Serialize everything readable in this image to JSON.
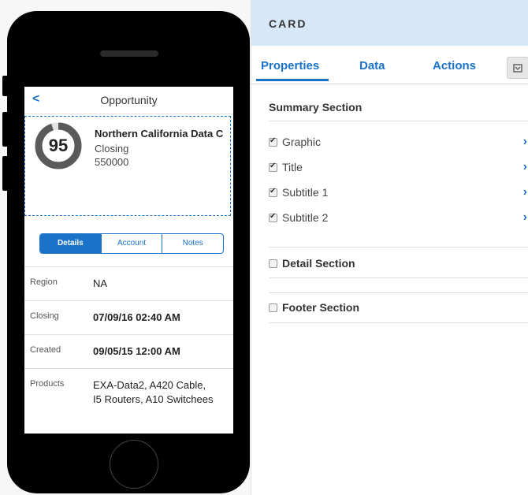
{
  "phone": {
    "nav": {
      "back": "<",
      "title": "Opportunity"
    },
    "summary": {
      "score": "95",
      "score_fraction": 0.95,
      "title": "Northern California Data C",
      "subtitle1": "Closing",
      "subtitle2": "550000"
    },
    "segments": [
      "Details",
      "Account",
      "Notes"
    ],
    "details": [
      {
        "label": "Region",
        "value": "NA",
        "bold": false
      },
      {
        "label": "Closing",
        "value": "07/09/16 02:40 AM",
        "bold": true
      },
      {
        "label": "Created",
        "value": "09/05/15 12:00 AM",
        "bold": true
      },
      {
        "label": "Products",
        "value_lines": [
          "EXA-Data2, A420 Cable,",
          "I5 Routers, A10 Switchees"
        ],
        "bold": false
      }
    ]
  },
  "panel": {
    "header": "CARD",
    "tabs": [
      "Properties",
      "Data",
      "Actions"
    ],
    "active_tab": "Properties",
    "summary_section": {
      "title": "Summary Section",
      "items": [
        {
          "label": "Graphic",
          "checked": true
        },
        {
          "label": "Title",
          "checked": true
        },
        {
          "label": "Subtitle 1",
          "checked": true
        },
        {
          "label": "Subtitle 2",
          "checked": true
        }
      ]
    },
    "detail_section": {
      "title": "Detail Section",
      "checked": false
    },
    "footer_section": {
      "title": "Footer Section",
      "checked": false
    }
  },
  "colors": {
    "accent": "#1a73c8",
    "header_bg": "#d6e8f7"
  }
}
